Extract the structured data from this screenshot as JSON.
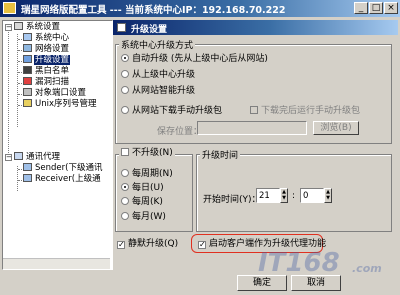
{
  "window": {
    "title": "瑞星网络版配置工具 --- 当前系统中心IP：192.168.70.222"
  },
  "tree": {
    "items": [
      {
        "label": "系统设置"
      },
      {
        "label": "系统中心"
      },
      {
        "label": "网络设置"
      },
      {
        "label": "升级设置"
      },
      {
        "label": "黑白名单"
      },
      {
        "label": "漏洞扫描"
      },
      {
        "label": "对象端口设置"
      },
      {
        "label": "Unix序列号管理"
      },
      {
        "label": "通讯代理"
      },
      {
        "label": "Sender(下级通讯"
      },
      {
        "label": "Receiver(上级通"
      }
    ]
  },
  "panel": {
    "title": "升级设置"
  },
  "method_group": {
    "title": "系统中心升级方式",
    "options": [
      {
        "label": "自动升级 (先从上级中心后从网站)"
      },
      {
        "label": "从上级中心升级"
      },
      {
        "label": "从网站智能升级"
      },
      {
        "label": "从网站下载手动升级包"
      }
    ],
    "auto_run_label": "下载完后运行手动升级包",
    "save_location_label": "保存位置：",
    "browse_label": "浏览(B)"
  },
  "frequency_group": {
    "no_upgrade_label": "不升级(N)",
    "options": [
      {
        "label": "每周期(N)"
      },
      {
        "label": "每日(U)"
      },
      {
        "label": "每周(K)"
      },
      {
        "label": "每月(W)"
      }
    ]
  },
  "time_group": {
    "title": "升级时间",
    "start_time_label": "开始时间(Y)：",
    "hour": "21",
    "minute": "0",
    "separator": ":"
  },
  "silent_upgrade_label": "静默升级(Q)",
  "client_proxy_label": "启动客户端作为升级代理功能",
  "buttons": {
    "ok": "确定",
    "cancel": "取消"
  },
  "watermark": {
    "text": "IT168",
    "sub": ".com"
  }
}
